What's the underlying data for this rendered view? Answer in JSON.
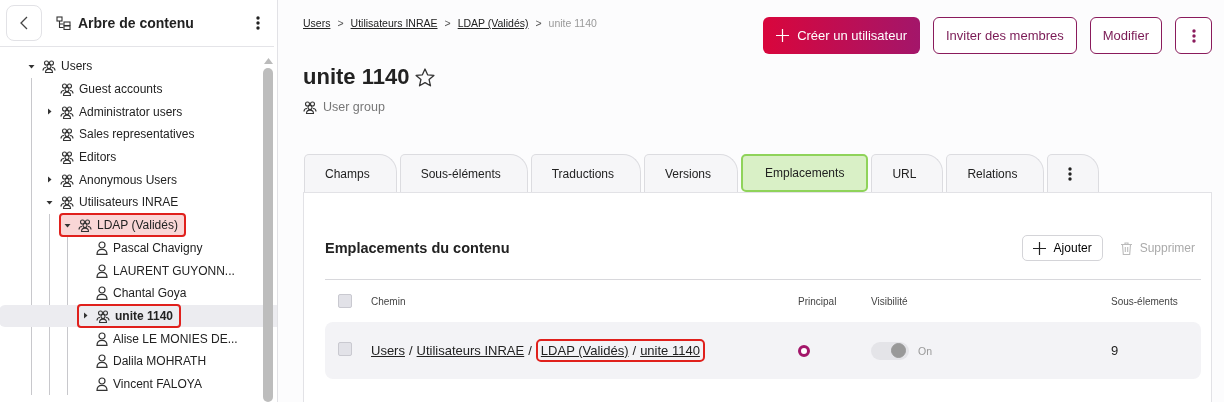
{
  "sidebar": {
    "title": "Arbre de contenu",
    "tree": [
      {
        "label": "Users",
        "kind": "group",
        "expanded": true,
        "selected": false,
        "highlighted": false,
        "children": [
          {
            "label": "Guest accounts",
            "kind": "group",
            "selected": false,
            "highlighted": false
          },
          {
            "label": "Administrator users",
            "kind": "group",
            "expanded": false,
            "selected": false,
            "highlighted": false
          },
          {
            "label": "Sales representatives",
            "kind": "group",
            "selected": false,
            "highlighted": false
          },
          {
            "label": "Editors",
            "kind": "group",
            "selected": false,
            "highlighted": false
          },
          {
            "label": "Anonymous Users",
            "kind": "group",
            "expanded": false,
            "selected": false,
            "highlighted": false
          },
          {
            "label": "Utilisateurs INRAE",
            "kind": "group",
            "expanded": true,
            "selected": false,
            "highlighted": false,
            "children": [
              {
                "label": "LDAP (Validés)",
                "kind": "group",
                "expanded": true,
                "selected": false,
                "highlighted": true,
                "children": [
                  {
                    "label": "Pascal Chavigny",
                    "kind": "user",
                    "selected": false,
                    "highlighted": false
                  },
                  {
                    "label": "LAURENT GUYONN...",
                    "kind": "user",
                    "selected": false,
                    "highlighted": false
                  },
                  {
                    "label": "Chantal Goya",
                    "kind": "user",
                    "selected": false,
                    "highlighted": false
                  },
                  {
                    "label": "unite 1140",
                    "kind": "group",
                    "expanded": false,
                    "selected": true,
                    "highlighted": true
                  },
                  {
                    "label": "Alise LE MONIES DE...",
                    "kind": "user",
                    "selected": false,
                    "highlighted": false
                  },
                  {
                    "label": "Dalila MOHRATH",
                    "kind": "user",
                    "selected": false,
                    "highlighted": false
                  },
                  {
                    "label": "Vincent FALOYA",
                    "kind": "user",
                    "selected": false,
                    "highlighted": false
                  }
                ]
              }
            ]
          }
        ]
      }
    ]
  },
  "breadcrumb": {
    "separator": ">",
    "items": [
      {
        "label": "Users",
        "link": true
      },
      {
        "label": "Utilisateurs INRAE",
        "link": true
      },
      {
        "label": "LDAP (Validés)",
        "link": true
      },
      {
        "label": "unite 1140",
        "link": false
      }
    ]
  },
  "actions": [
    {
      "label": "Créer un utilisateur",
      "kind": "primary"
    },
    {
      "label": "Inviter des membres",
      "kind": "secondary"
    },
    {
      "label": "Modifier",
      "kind": "secondary"
    },
    {
      "kind": "more"
    }
  ],
  "title": "unite 1140",
  "favorite": false,
  "subtitle": "User group",
  "tabs": [
    {
      "label": "Champs",
      "selected": false
    },
    {
      "label": "Sous-éléments",
      "selected": false
    },
    {
      "label": "Traductions",
      "selected": false
    },
    {
      "label": "Versions",
      "selected": false
    },
    {
      "label": "Emplacements",
      "selected": true
    },
    {
      "label": "URL",
      "selected": false
    },
    {
      "label": "Relations",
      "selected": false
    },
    {
      "kind": "more",
      "selected": false
    }
  ],
  "card": {
    "title": "Emplacements du contenu",
    "add_button": "Ajouter",
    "delete_button": {
      "label": "Supprimer",
      "disabled": true
    },
    "table": {
      "all_checked": false,
      "columns": [
        "Chemin",
        "Principal",
        "Visibilité",
        "Sous-élements"
      ],
      "rows": [
        {
          "checked": false,
          "separator": "/",
          "path": [
            {
              "label": "Users",
              "highlighted": false
            },
            {
              "label": "Utilisateurs INRAE",
              "highlighted": false
            },
            {
              "label": "LDAP (Validés)",
              "highlighted": true
            },
            {
              "label": "unite 1140",
              "highlighted": true
            }
          ],
          "principal": true,
          "visibility": {
            "on": true,
            "disabled": true,
            "label": "On"
          },
          "children_count": "9"
        }
      ]
    }
  }
}
